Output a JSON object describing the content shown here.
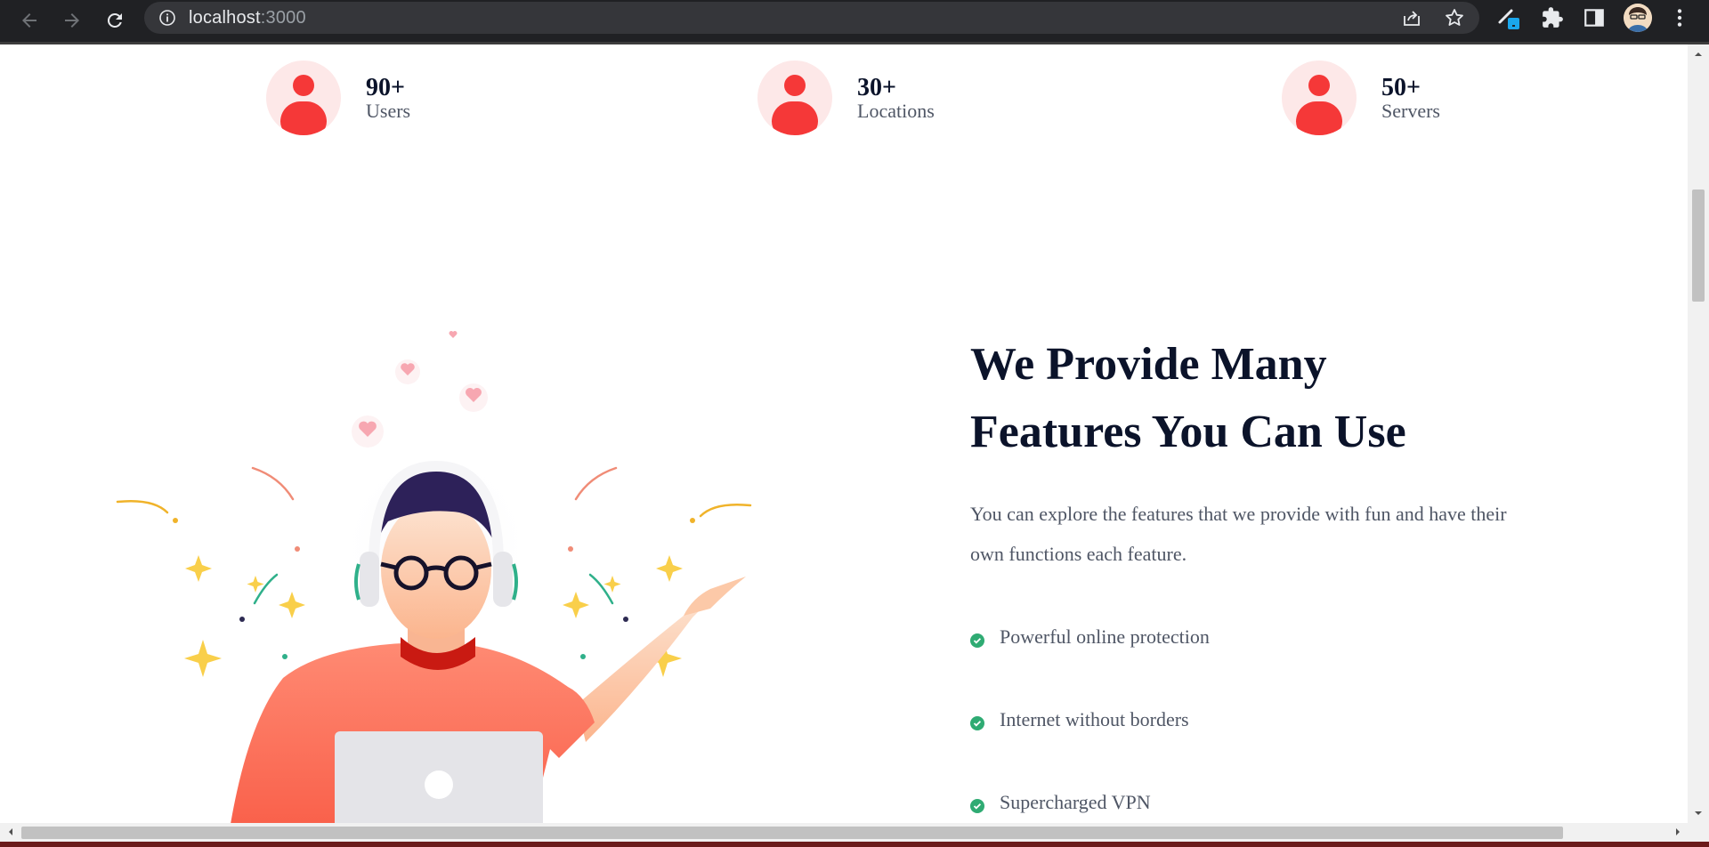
{
  "browser": {
    "url_host": "localhost",
    "url_port": ":3000"
  },
  "stats": [
    {
      "value": "90+",
      "label": "Users"
    },
    {
      "value": "30+",
      "label": "Locations"
    },
    {
      "value": "50+",
      "label": "Servers"
    }
  ],
  "features": {
    "title_line1": "We Provide Many",
    "title_line2": "Features You Can Use",
    "description": "You can explore the features that we provide with fun and have their own functions each feature.",
    "items": [
      "Powerful online protection",
      "Internet without borders",
      "Supercharged VPN"
    ]
  },
  "colors": {
    "accent_red": "#f53838",
    "check_green": "#2fab73",
    "heading": "#0b132a",
    "body_text": "#4f5665"
  },
  "icons": [
    "back-arrow-icon",
    "forward-arrow-icon",
    "reload-icon",
    "info-icon",
    "share-icon",
    "star-icon",
    "extension-brush-icon",
    "puzzle-icon",
    "side-panel-icon",
    "menu-dots-icon",
    "user-icon",
    "check-circle-icon"
  ]
}
